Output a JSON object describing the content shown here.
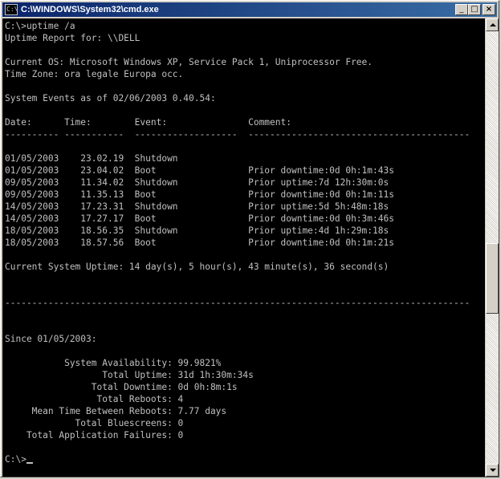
{
  "window": {
    "title": "C:\\WINDOWS\\System32\\cmd.exe",
    "icon_label": "C:\\",
    "minimize": "_",
    "maximize": "□",
    "close": "×"
  },
  "console": {
    "lines": [
      "C:\\>uptime /a",
      "Uptime Report for: \\\\DELL",
      "",
      "Current OS: Microsoft Windows XP, Service Pack 1, Uniprocessor Free.",
      "Time Zone: ora legale Europa occ.",
      "",
      "System Events as of 02/06/2003 0.40.54:",
      "",
      "Date:      Time:        Event:               Comment:",
      "---------- -----------  -------------------  -----------------------------------------",
      "",
      "01/05/2003    23.02.19  Shutdown",
      "01/05/2003    23.04.02  Boot                 Prior downtime:0d 0h:1m:43s",
      "09/05/2003    11.34.02  Shutdown             Prior uptime:7d 12h:30m:0s",
      "09/05/2003    11.35.13  Boot                 Prior downtime:0d 0h:1m:11s",
      "14/05/2003    17.23.31  Shutdown             Prior uptime:5d 5h:48m:18s",
      "14/05/2003    17.27.17  Boot                 Prior downtime:0d 0h:3m:46s",
      "18/05/2003    18.56.35  Shutdown             Prior uptime:4d 1h:29m:18s",
      "18/05/2003    18.57.56  Boot                 Prior downtime:0d 0h:1m:21s",
      "",
      "Current System Uptime: 14 day(s), 5 hour(s), 43 minute(s), 36 second(s)",
      "",
      "",
      "--------------------------------------------------------------------------------------",
      "",
      "",
      "Since 01/05/2003:",
      "",
      "           System Availability: 99.9821%",
      "                  Total Uptime: 31d 1h:30m:34s",
      "                Total Downtime: 0d 0h:8m:1s",
      "                 Total Reboots: 4",
      "     Mean Time Between Reboots: 7.77 days",
      "             Total Bluescreens: 0",
      "    Total Application Failures: 0",
      "",
      "C:\\>"
    ]
  }
}
